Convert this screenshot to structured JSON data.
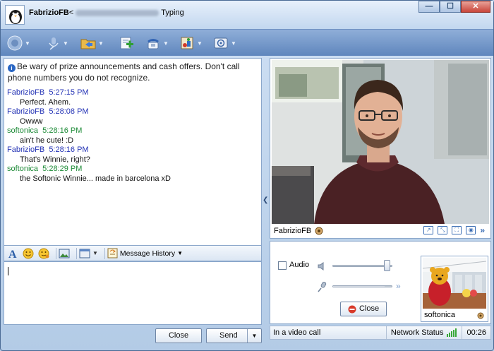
{
  "titlebar": {
    "name": "FabrizioFB",
    "bracket": "<",
    "status": "Typing"
  },
  "window_buttons": [
    "—",
    "☐",
    "✕"
  ],
  "toolbar": {
    "icons": [
      "contact-card-icon",
      "microphone-icon",
      "folder-share-icon",
      "add-contacts-icon",
      "phone-icon",
      "activities-icon",
      "games-icon"
    ]
  },
  "chat": {
    "warning": "Be wary of prize announcements and cash offers. Don't call phone numbers you do not recognize.",
    "messages": [
      {
        "sender": "FabrizioFB",
        "time": "5:27:15 PM",
        "text": "Perfect. Ahem.",
        "color": "#2332b5"
      },
      {
        "sender": "FabrizioFB",
        "time": "5:28:08 PM",
        "text": "Owww",
        "color": "#2332b5"
      },
      {
        "sender": "softonica",
        "time": "5:28:16 PM",
        "text": "ain't he cute! :D",
        "color": "#1c8a36"
      },
      {
        "sender": "FabrizioFB",
        "time": "5:28:16 PM",
        "text": "That's Winnie, right?",
        "color": "#2332b5"
      },
      {
        "sender": "softonica",
        "time": "5:28:29 PM",
        "text": "the Softonic Winnie... made in barcelona xD",
        "color": "#1c8a36"
      }
    ]
  },
  "format_bar": {
    "history_label": "Message History"
  },
  "buttons": {
    "close": "Close",
    "send": "Send",
    "video_close": "Close"
  },
  "video": {
    "caller_name": "FabrizioFB",
    "self_name": "softonica"
  },
  "call": {
    "audio_label": "Audio",
    "volume_level": 0.92,
    "mic_level": 0.88
  },
  "status": {
    "text": "In a video call",
    "network_label": "Network Status",
    "duration": "00:26"
  }
}
